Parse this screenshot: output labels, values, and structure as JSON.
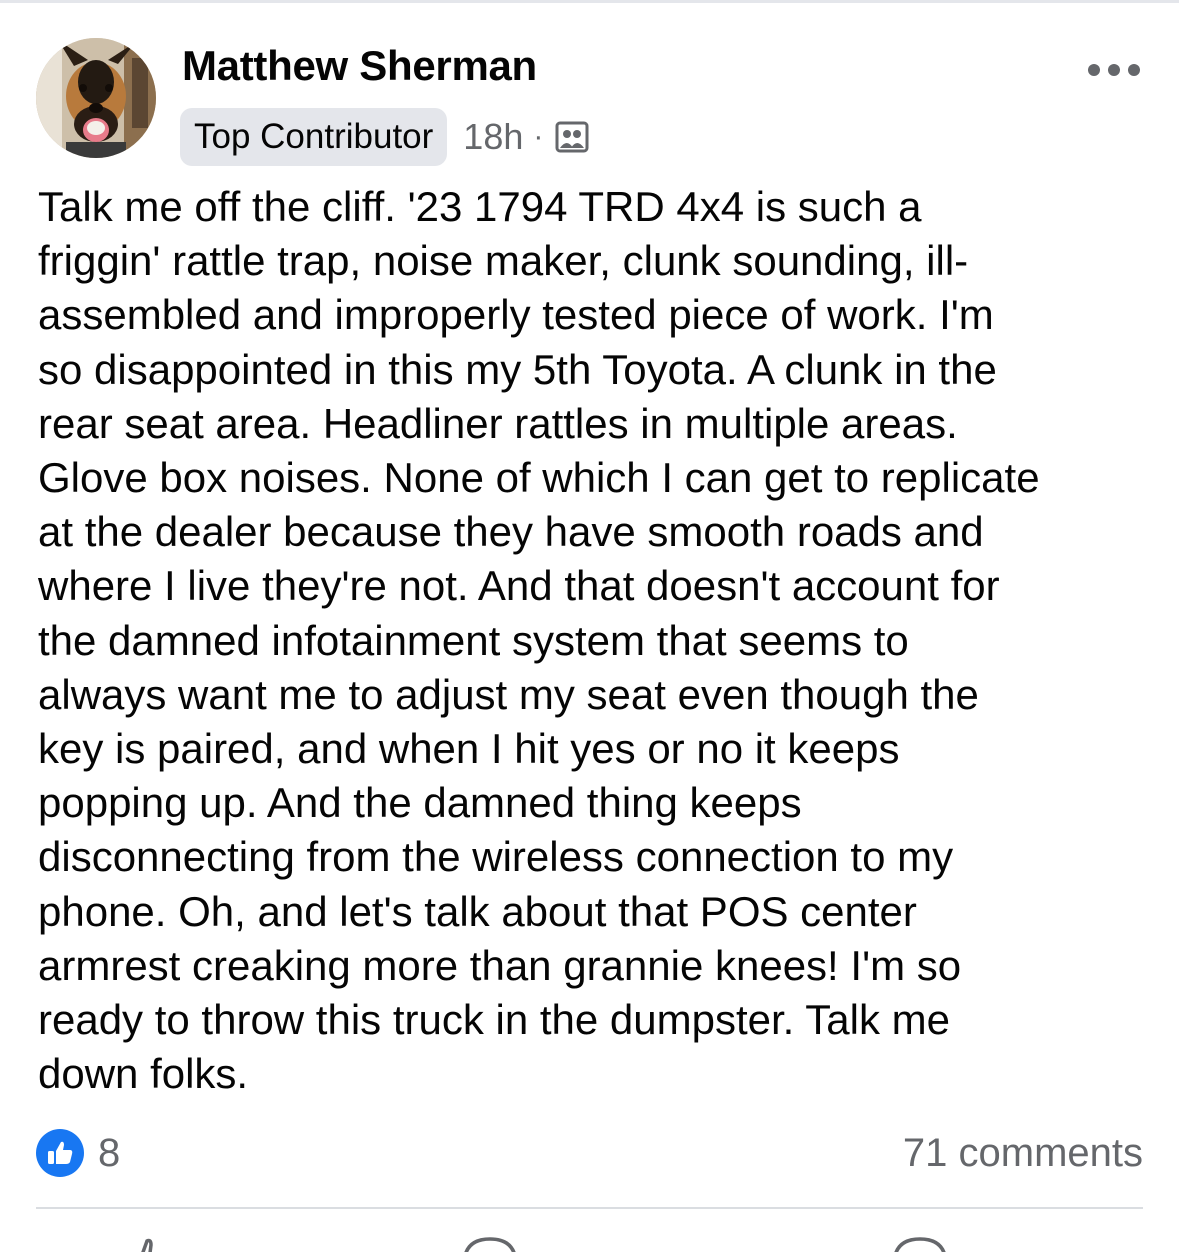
{
  "post": {
    "author": "Matthew Sherman",
    "badge": "Top Contributor",
    "time": "18h",
    "separator": "·",
    "audience_icon": "group-members-icon",
    "text": "Talk me off the cliff. '23 1794 TRD 4x4 is such a\nfriggin' rattle trap, noise maker, clunk sounding, ill-\nassembled and improperly tested piece of work. I'm\nso disappointed in this my 5th Toyota.  A clunk in the\nrear seat area.  Headliner rattles in multiple areas.\nGlove box noises. None of which I can get to replicate\nat the dealer because they have smooth roads and\nwhere I live they're not. And that doesn't account for\nthe damned infotainment system that seems to\nalways want me to adjust my seat even though the\nkey is paired, and when I hit yes or no it keeps\npopping up.  And the damned thing keeps\ndisconnecting from the wireless connection to my\nphone. Oh, and let's talk about that POS center\narmrest creaking more than grannie knees!  I'm so\nready to throw this truck in the dumpster.  Talk me\ndown folks."
  },
  "stats": {
    "reaction_icon": "like-icon",
    "reaction_count": "8",
    "comments": "71 comments"
  },
  "actions": [
    {
      "icon": "like-outline-icon"
    },
    {
      "icon": "comment-icon"
    },
    {
      "icon": "share-icon"
    }
  ],
  "colors": {
    "accent": "#1877f2",
    "secondary_text": "#65676b",
    "badge_bg": "#e4e6eb"
  }
}
